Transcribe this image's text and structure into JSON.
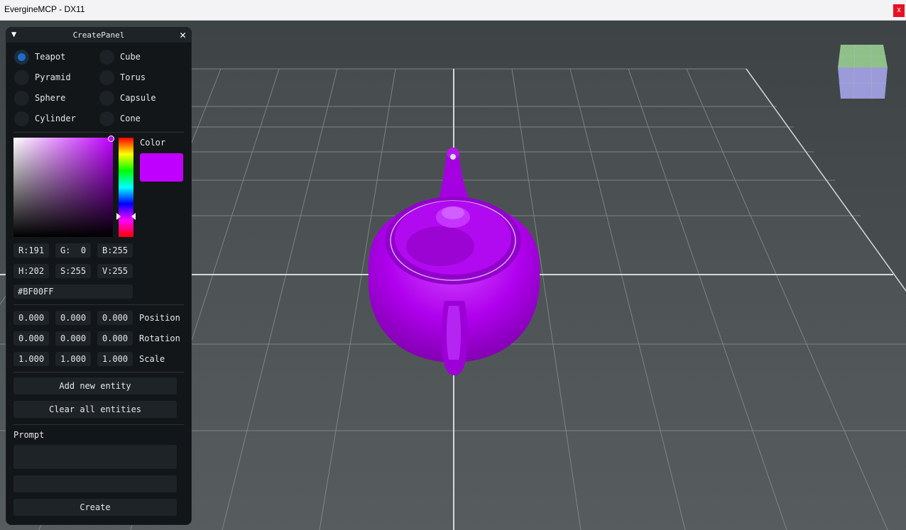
{
  "window": {
    "title": "EvergineMCP - DX11",
    "close_label": "x"
  },
  "colors": {
    "accent": "#1e6cc9",
    "teapot": "#bf00ff",
    "panel_bg": "#121619",
    "field_bg": "#1e2327"
  },
  "panel": {
    "title": "CreatePanel",
    "collapse_icon": "triangle-down-icon",
    "close_icon": "close-icon",
    "close_glyph": "✕",
    "collapse_glyph": "▼",
    "shapes": [
      {
        "label": "Teapot",
        "selected": true
      },
      {
        "label": "Cube",
        "selected": false
      },
      {
        "label": "Pyramid",
        "selected": false
      },
      {
        "label": "Torus",
        "selected": false
      },
      {
        "label": "Sphere",
        "selected": false
      },
      {
        "label": "Capsule",
        "selected": false
      },
      {
        "label": "Cylinder",
        "selected": false
      },
      {
        "label": "Cone",
        "selected": false
      }
    ],
    "color": {
      "label": "Color",
      "r": "R:191",
      "g": "G:  0",
      "b": "B:255",
      "h": "H:202",
      "s": "S:255",
      "v": "V:255",
      "hex": "#BF00FF"
    },
    "transform": {
      "position": {
        "label": "Position",
        "x": "0.000",
        "y": "0.000",
        "z": "0.000"
      },
      "rotation": {
        "label": "Rotation",
        "x": "0.000",
        "y": "0.000",
        "z": "0.000"
      },
      "scale": {
        "label": "Scale",
        "x": "1.000",
        "y": "1.000",
        "z": "1.000"
      }
    },
    "add_button": "Add new entity",
    "clear_button": "Clear all entities",
    "prompt_label": "Prompt",
    "prompt_value": "",
    "prompt_value2": "",
    "create_button": "Create"
  }
}
